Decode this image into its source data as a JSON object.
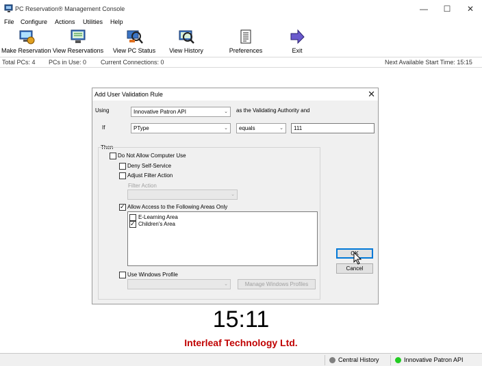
{
  "window": {
    "title": "PC Reservation® Management Console"
  },
  "menu": [
    "File",
    "Configure",
    "Actions",
    "Utilities",
    "Help"
  ],
  "toolbar": {
    "make_reservation": "Make Reservation",
    "view_reservations": "View Reservations",
    "view_pc_status": "View PC Status",
    "view_history": "View History",
    "preferences": "Preferences",
    "exit": "Exit"
  },
  "status": {
    "total_pcs": "Total PCs: 4",
    "pcs_in_use": "PCs in Use: 0",
    "current_connections": "Current Connections: 0",
    "next_available": "Next Available Start Time: 15:15"
  },
  "dialog": {
    "title": "Add User Validation Rule",
    "using_label": "Using",
    "using_value": "Innovative Patron API",
    "authority_text": "as the Validating Authority and",
    "if_label": "If",
    "field_value": "PType",
    "operator_value": "equals",
    "compare_value": "111",
    "then_label": "Then",
    "do_not_allow": {
      "label": "Do Not Allow Computer Use",
      "checked": false
    },
    "deny_self_service": {
      "label": "Deny Self-Service",
      "checked": false
    },
    "adjust_filter": {
      "label": "Adjust Filter Action",
      "checked": false
    },
    "filter_action_label": "Filter Action",
    "allow_access": {
      "label": "Allow Access to the Following Areas Only",
      "checked": true
    },
    "areas": [
      {
        "label": "E-Learning Area",
        "checked": false
      },
      {
        "label": "Children's Area",
        "checked": true
      }
    ],
    "use_windows_profile": {
      "label": "Use Windows Profile",
      "checked": false
    },
    "manage_profiles_label": "Manage Windows Profiles",
    "ok_label": "OK",
    "cancel_label": "Cancel"
  },
  "clock": "15:11",
  "brand": "Interleaf Technology Ltd.",
  "bottom": {
    "central_history": "Central History",
    "patron_api": "Innovative Patron API",
    "colors": {
      "central_history": "#808080",
      "patron_api": "#22cc22"
    }
  },
  "colors": {
    "accent": "#0078d7",
    "brand": "#c00000"
  }
}
